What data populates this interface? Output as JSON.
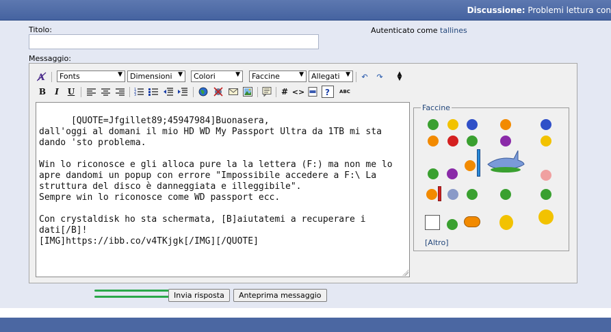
{
  "header": {
    "label": "Discussione:",
    "thread_title": "Problemi lettura con"
  },
  "form": {
    "title_label": "Titolo:",
    "title_value": "",
    "auth_prefix": "Autenticato come",
    "auth_user": "tallines",
    "message_label": "Messaggio:"
  },
  "toolbar": {
    "fonts": "Fonts",
    "sizes": "Dimensioni",
    "colors": "Colori",
    "smilies": "Faccine",
    "attachments": "Allegati",
    "bold": "B",
    "italic": "I",
    "underline": "U",
    "code_hash": "#",
    "code_tag": "<>",
    "abc": "ABC"
  },
  "message": {
    "text": "[QUOTE=Jfgillet89;45947984]Buonasera,\ndall'oggi al domani il mio HD WD My Passport Ultra da 1TB mi sta dando 'sto problema.\n\nWin lo riconosce e gli alloca pure la la lettera (F:) ma non me lo apre dandomi un popup con errore \"Impossibile accedere a F:\\ La struttura del disco è danneggiata e illeggibile\".\nSempre win lo riconosce come WD passport ecc.\n\nCon crystaldisk ho sta schermata, [B]aiutatemi a recuperare i dati[/B]!\n[IMG]https://ibb.co/v4TKjgk[/IMG][/QUOTE]"
  },
  "smilies_panel": {
    "legend": "Faccine",
    "more": "[Altro]",
    "colors": {
      "yellow": "#f2c200",
      "orange": "#f28a00",
      "red": "#d42020",
      "green": "#3aa030",
      "blue": "#3050c8",
      "purple": "#8a2aa8"
    }
  },
  "buttons": {
    "submit": "Invia risposta",
    "preview": "Anteprima messaggio"
  }
}
